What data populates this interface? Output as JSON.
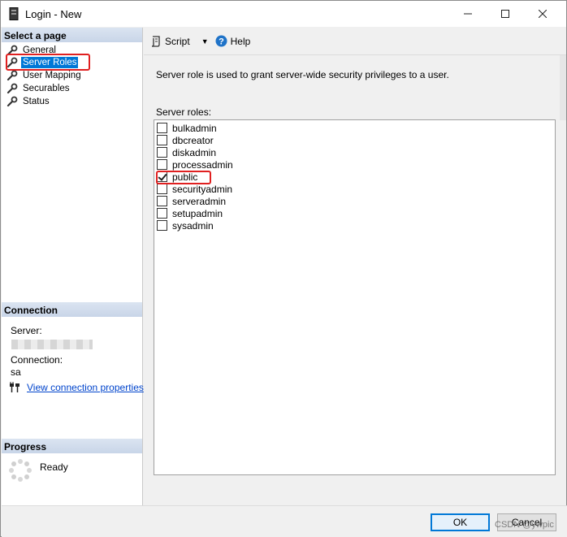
{
  "window": {
    "title": "Login - New",
    "controls": {
      "minimize": "minimize",
      "maximize": "maximize",
      "close": "close"
    }
  },
  "left_pane": {
    "select_page_header": "Select a page",
    "pages": [
      {
        "label": "General",
        "icon": "wrench-icon",
        "selected": false
      },
      {
        "label": "Server Roles",
        "icon": "wrench-icon",
        "selected": true
      },
      {
        "label": "User Mapping",
        "icon": "wrench-icon",
        "selected": false
      },
      {
        "label": "Securables",
        "icon": "wrench-icon",
        "selected": false
      },
      {
        "label": "Status",
        "icon": "wrench-icon",
        "selected": false
      }
    ],
    "connection_header": "Connection",
    "server_label": "Server:",
    "connection_label": "Connection:",
    "connection_value": "sa",
    "view_connection_link": "View connection properties",
    "progress_header": "Progress",
    "progress_status": "Ready"
  },
  "toolbar": {
    "script_label": "Script",
    "help_label": "Help"
  },
  "main": {
    "description": "Server role is used to grant server-wide security privileges to a user.",
    "roles_label": "Server roles:",
    "roles": [
      {
        "name": "bulkadmin",
        "checked": false
      },
      {
        "name": "dbcreator",
        "checked": false
      },
      {
        "name": "diskadmin",
        "checked": false
      },
      {
        "name": "processadmin",
        "checked": false
      },
      {
        "name": "public",
        "checked": true
      },
      {
        "name": "securityadmin",
        "checked": false
      },
      {
        "name": "serveradmin",
        "checked": false
      },
      {
        "name": "setupadmin",
        "checked": false
      },
      {
        "name": "sysadmin",
        "checked": false
      }
    ]
  },
  "footer": {
    "ok_label": "OK",
    "cancel_label": "Cancel",
    "watermark": "CSDN @ywpic"
  },
  "colors": {
    "selection": "#0078d7",
    "highlight_box": "#e02020",
    "link": "#0044cc"
  }
}
